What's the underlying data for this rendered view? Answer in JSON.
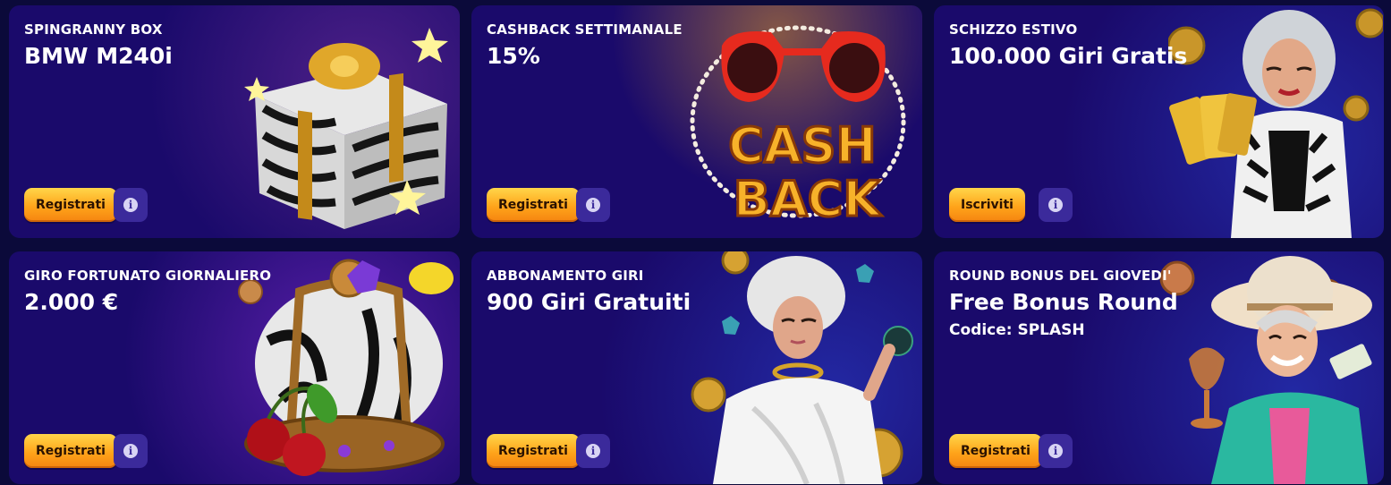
{
  "cards": [
    {
      "label": "SPINGRANNY BOX",
      "title": "BMW M240i",
      "button": "Registrati",
      "info_icon": "info-icon",
      "art": "zebra-gift-box"
    },
    {
      "label": "CASHBACK SETTIMANALE",
      "title": "15%",
      "button": "Registrati",
      "info_icon": "info-icon",
      "art": "cashback-sunglasses",
      "art_text_1": "CASH",
      "art_text_2": "BACK"
    },
    {
      "label": "SCHIZZO ESTIVO",
      "title": "100.000 Giri Gratis",
      "button": "Iscriviti",
      "info_icon": "info-icon",
      "art": "granny-with-tickets"
    },
    {
      "label": "GIRO FORTUNATO GIORNALIERO",
      "title": "2.000 €",
      "button": "Registrati",
      "info_icon": "info-icon",
      "art": "zebra-crown"
    },
    {
      "label": "ABBONAMENTO GIRI",
      "title": "900 Giri Gratuiti",
      "button": "Registrati",
      "info_icon": "info-icon",
      "art": "granny-toga"
    },
    {
      "label": "ROUND BONUS DEL GIOVEDI'",
      "title": "Free Bonus Round",
      "code": "Codice: SPLASH",
      "button": "Registrati",
      "info_icon": "info-icon",
      "art": "granny-with-hat"
    }
  ],
  "colors": {
    "background": "#0b0a3a",
    "card": "#1a0a6b",
    "button_gradient_top": "#ffd64a",
    "button_gradient_bottom": "#f58410",
    "info_button": "#3b2a9b"
  }
}
